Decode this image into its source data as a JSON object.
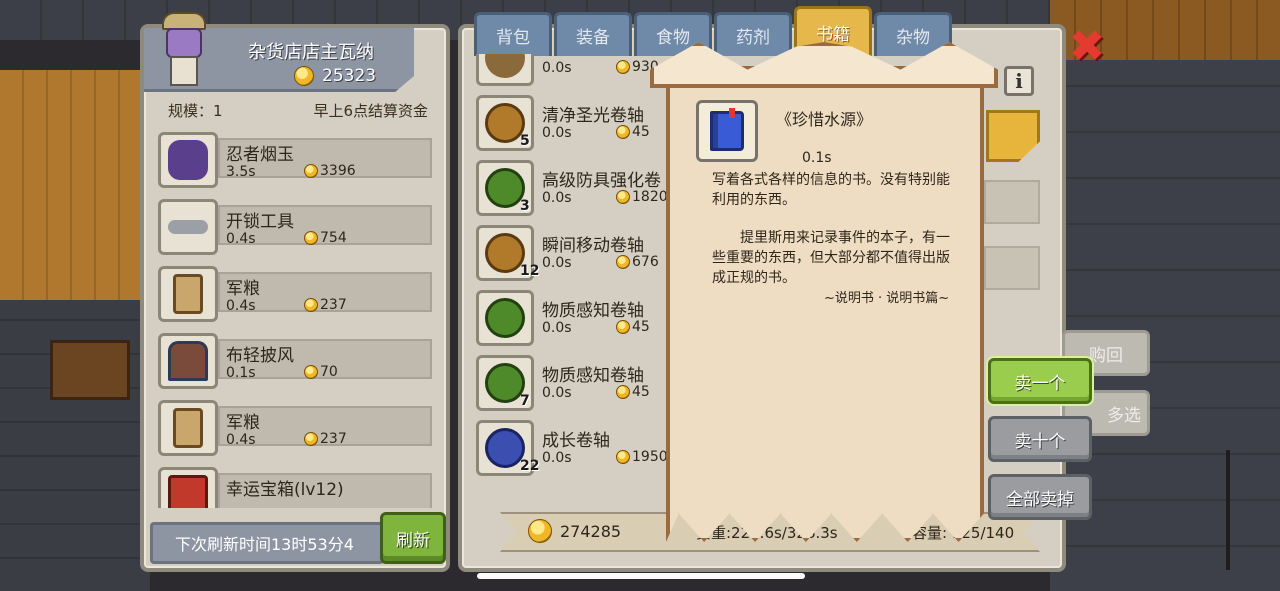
{
  "merchant": {
    "name": "杂货店店主瓦纳",
    "gold": "25323",
    "scale": "规模：1",
    "settlement": "早上6点结算资金"
  },
  "shop_items": [
    {
      "name": "忍者烟玉",
      "time": "3.5s",
      "price": "3396",
      "icon": "ninja-smoke-bomb-icon",
      "color": "#5a3f8c"
    },
    {
      "name": "开锁工具",
      "time": "0.4s",
      "price": "754",
      "icon": "lockpick-key-icon",
      "color": "#9aa0a6"
    },
    {
      "name": "军粮",
      "time": "0.4s",
      "price": "237",
      "icon": "ration-icon",
      "color": "#c9a66b"
    },
    {
      "name": "布轻披风",
      "time": "0.1s",
      "price": "70",
      "icon": "cloak-icon",
      "color": "#7a4a3a"
    },
    {
      "name": "军粮",
      "time": "0.4s",
      "price": "237",
      "icon": "ration-icon",
      "color": "#c9a66b"
    },
    {
      "name": "幸运宝箱(lv12)",
      "time": "",
      "price": "",
      "icon": "lucky-chest-icon",
      "color": "#c0392b"
    }
  ],
  "refresh": {
    "timer_text": "下次刷新时间13时53分4",
    "button": "刷新"
  },
  "tabs": [
    {
      "label": "背包",
      "active": false
    },
    {
      "label": "装备",
      "active": false
    },
    {
      "label": "食物",
      "active": false
    },
    {
      "label": "药剂",
      "active": false
    },
    {
      "label": "书籍",
      "active": true
    },
    {
      "label": "杂物",
      "active": false
    }
  ],
  "inventory": [
    {
      "name": "",
      "time": "0.0s",
      "price": "930",
      "qty": "",
      "icon": "scroll-icon",
      "color": "#8a6a3a"
    },
    {
      "name": "清净圣光卷轴",
      "time": "0.0s",
      "price": "45",
      "qty": "5",
      "icon": "scroll-icon",
      "color": "#b07a2a"
    },
    {
      "name": "高级防具强化卷",
      "time": "0.0s",
      "price": "1820",
      "qty": "3",
      "icon": "scroll-icon",
      "color": "#4f8a2a"
    },
    {
      "name": "瞬间移动卷轴",
      "time": "0.0s",
      "price": "676",
      "qty": "12",
      "icon": "scroll-icon",
      "color": "#b07a2a"
    },
    {
      "name": "物质感知卷轴",
      "time": "0.0s",
      "price": "45",
      "qty": "",
      "icon": "scroll-icon",
      "color": "#4f8a2a"
    },
    {
      "name": "物质感知卷轴",
      "time": "0.0s",
      "price": "45",
      "qty": "7",
      "icon": "scroll-icon",
      "color": "#4f8a2a"
    },
    {
      "name": "成长卷轴",
      "time": "0.0s",
      "price": "1950",
      "qty": "22",
      "icon": "scroll-icon",
      "color": "#3a4fb0"
    }
  ],
  "footer": {
    "gold": "274285",
    "weight": "负重:227.6s/326.3s",
    "capacity": "容量: 125/140"
  },
  "popup": {
    "title": "《珍惜水源》",
    "time": "0.1s",
    "description": "写着各式各样的信息的书。没有特别能利用的东西。",
    "lore": "提里斯用来记录事件的本子，有一些重要的东西，但大部分都不值得出版成正规的书。",
    "source": "~说明书 · 说明书篇~"
  },
  "actions": {
    "buyback": "购回",
    "multi_select": "多选",
    "sell_one": "卖一个",
    "sell_ten": "卖十个",
    "sell_all": "全部卖掉"
  },
  "close_icon": "close-x-icon",
  "info_icon": "info-icon",
  "colors": {
    "accent_green": "#9acc4e",
    "tab_active": "#e6b74a",
    "close_red": "#e33b2f"
  }
}
